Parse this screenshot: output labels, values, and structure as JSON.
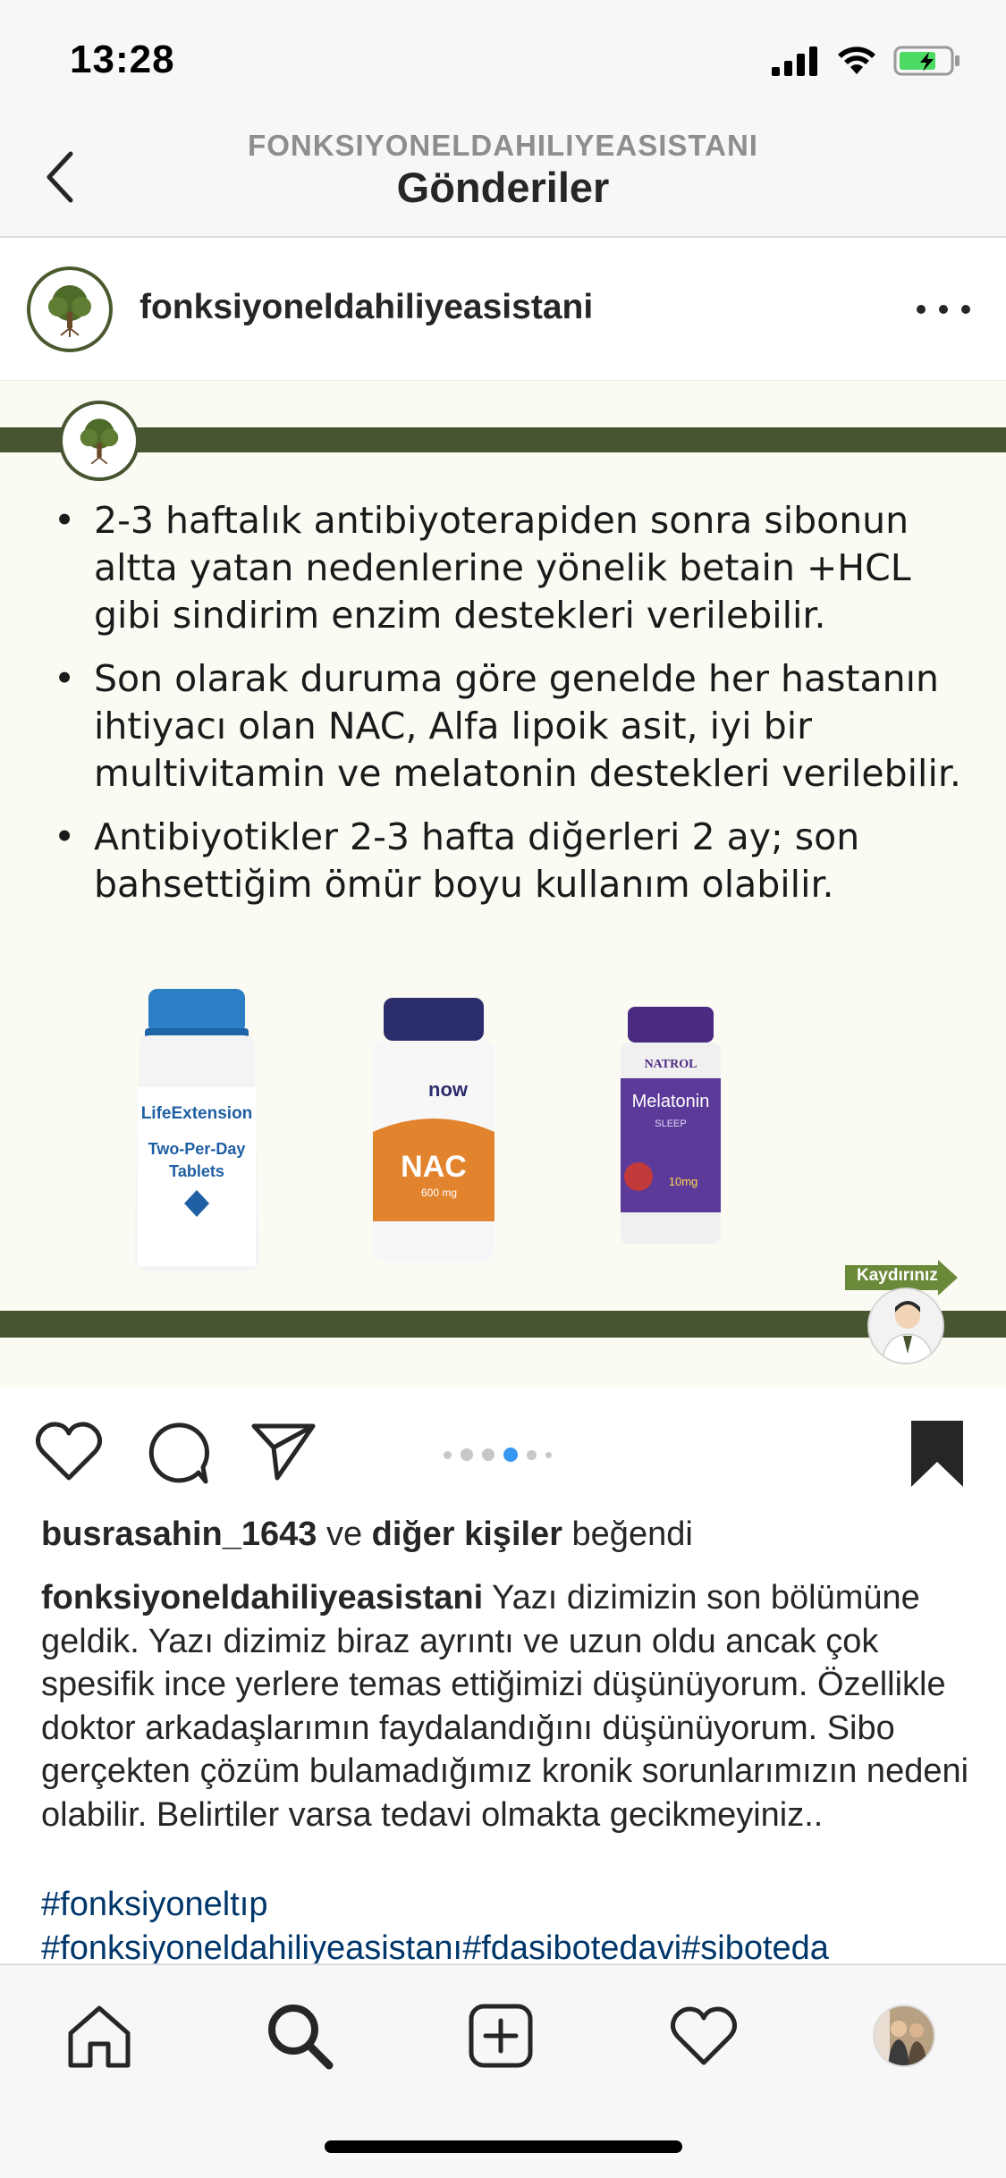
{
  "status_bar": {
    "time": "13:28"
  },
  "header": {
    "subtitle": "FONKSIYONELDAHILIYEASISTANI",
    "title": "Gönderiler"
  },
  "post": {
    "username": "fonksiyoneldahiliyeasistani",
    "slide": {
      "bullets": [
        "2-3 haftalık antibiyoterapiden sonra sibonun altta yatan nedenlerine yönelik betain +HCL gibi sindirim enzim destekleri verilebilir.",
        "Son olarak duruma göre genelde her hastanın ihtiyacı olan NAC, Alfa lipoik asit, iyi bir multivitamin ve melatonin destekleri verilebilir.",
        "Antibiyotikler 2-3 hafta diğerleri 2 ay; son bahsettiğim ömür boyu kullanım olabilir."
      ],
      "products": [
        {
          "brand": "LifeExtension",
          "name": "Two-Per-Day Tablets"
        },
        {
          "brand": "now",
          "name": "NAC",
          "dose": "600 mg"
        },
        {
          "brand": "NATROL",
          "name": "Melatonin",
          "sub": "SLEEP",
          "dose": "10mg"
        }
      ],
      "swipe_label": "Kaydırınız"
    },
    "carousel": {
      "active_index": 3,
      "count": 6
    },
    "likes": {
      "user": "busrasahin_1643",
      "connector": " ve ",
      "others": "diğer kişiler",
      "suffix": " beğendi"
    },
    "caption": {
      "username": "fonksiyoneldahiliyeasistani",
      "text": " Yazı dizimizin son bölümüne geldik. Yazı dizimiz biraz ayrıntı ve uzun oldu ancak çok spesifik ince yerlere temas ettiğimizi düşünüyorum. Özellikle doktor arkadaşlarımın faydalandığını düşünüyorum. Sibo gerçekten çözüm bulamadığımız kronik sorunlarımızın nedeni olabilir. Belirtiler varsa tedavi olmakta gecikmeyiniz..",
      "hashtag_line1": "#fonksiyoneltıp",
      "hashtag_line2": "#fonksiyoneldahiliyeasistanı#fdasibotedavi#siboteda"
    }
  },
  "tab_bar": {
    "items": [
      "home-icon",
      "search-icon",
      "new-post-icon",
      "activity-heart-icon",
      "profile-avatar"
    ]
  },
  "colors": {
    "brand_green": "#485531",
    "carousel_active": "#3897f0",
    "hashtag": "#00376b"
  }
}
